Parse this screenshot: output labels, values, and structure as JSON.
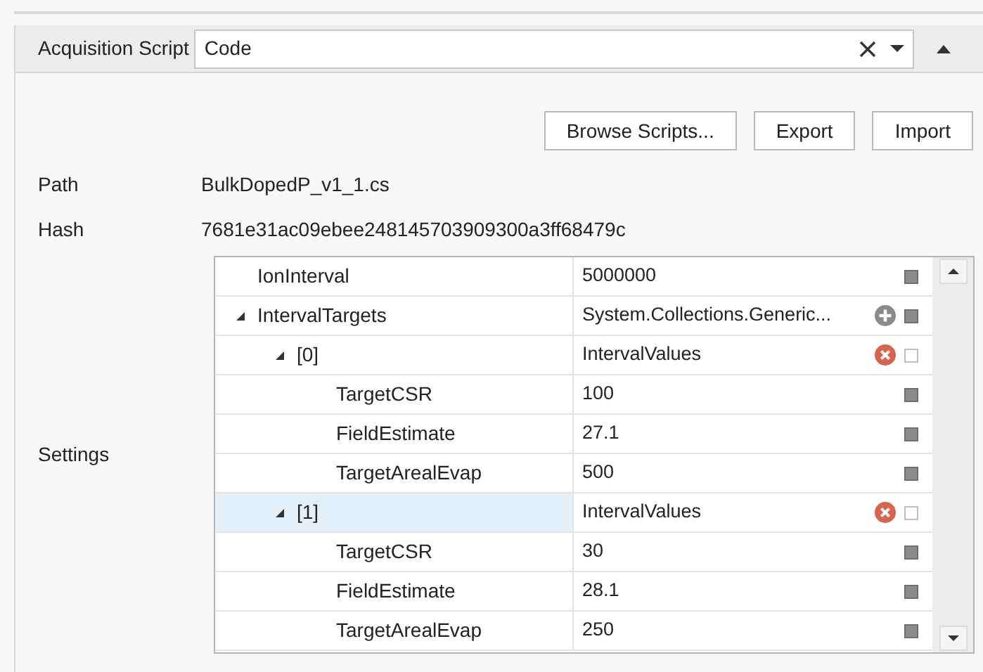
{
  "header": {
    "label": "Acquisition Script",
    "combo_value": "Code",
    "expanded": true
  },
  "buttons": [
    "Browse Scripts...",
    "Export",
    "Import"
  ],
  "fields": [
    {
      "label": "Path",
      "value": "BulkDopedP_v1_1.cs"
    },
    {
      "label": "Hash",
      "value": "7681e31ac09ebee248145703909300a3ff68479c"
    }
  ],
  "settings": {
    "label": "Settings",
    "rows": [
      {
        "name": "IonInterval",
        "value": "5000000",
        "selected": false,
        "filled": true
      },
      {
        "name": "IntervalTargets",
        "value": "System.Collections.Generic...",
        "selected": false,
        "filled": true,
        "kind": "add",
        "expanded": true,
        "children": [
          {
            "name": "[0]",
            "value": "IntervalValues",
            "selected": false,
            "filled": false,
            "kind": "remove",
            "expanded": true,
            "children": [
              {
                "name": "TargetCSR",
                "value": "100",
                "selected": false,
                "filled": true
              },
              {
                "name": "FieldEstimate",
                "value": "27.1",
                "selected": false,
                "filled": true
              },
              {
                "name": "TargetArealEvap",
                "value": "500",
                "selected": false,
                "filled": true
              }
            ]
          },
          {
            "name": "[1]",
            "value": "IntervalValues",
            "selected": true,
            "filled": false,
            "kind": "remove",
            "expanded": true,
            "children": [
              {
                "name": "TargetCSR",
                "value": "30",
                "selected": false,
                "filled": true
              },
              {
                "name": "FieldEstimate",
                "value": "28.1",
                "selected": false,
                "filled": true
              },
              {
                "name": "TargetArealEvap",
                "value": "250",
                "selected": false,
                "filled": true
              }
            ]
          }
        ]
      }
    ]
  }
}
